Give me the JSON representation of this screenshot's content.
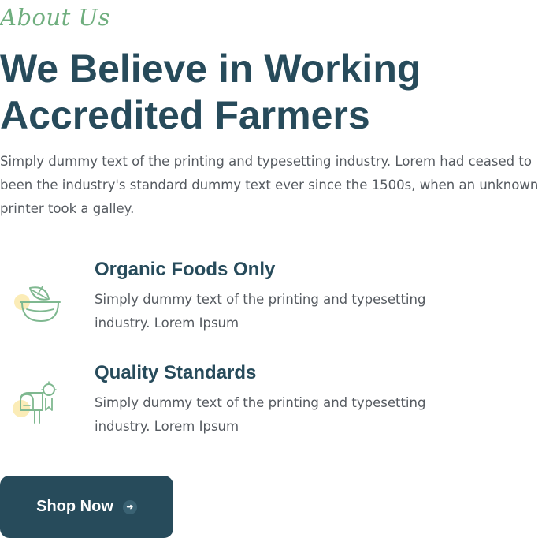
{
  "section": {
    "eyebrow": "About Us",
    "headline_line1": "We Believe in Working",
    "headline_line2": "Accredited Farmers",
    "intro": "Simply dummy text of the printing and typesetting industry. Lorem had ceased to been the industry's standard dummy text ever since the 1500s, when an unknown printer took a galley."
  },
  "features": [
    {
      "icon": "organic-bowl-icon",
      "title": "Organic Foods Only",
      "text": "Simply dummy text of the printing and typesetting industry. Lorem Ipsum"
    },
    {
      "icon": "mailbox-icon",
      "title": "Quality Standards",
      "text": "Simply dummy text of the printing and typesetting industry. Lorem Ipsum"
    }
  ],
  "cta": {
    "label": "Shop Now",
    "icon": "arrow-right-icon"
  },
  "colors": {
    "heading": "#274b5b",
    "accent_green": "#6fae7e",
    "accent_yellow": "#fbecb7",
    "body_text": "#555a60",
    "button_bg": "#274b5b"
  }
}
